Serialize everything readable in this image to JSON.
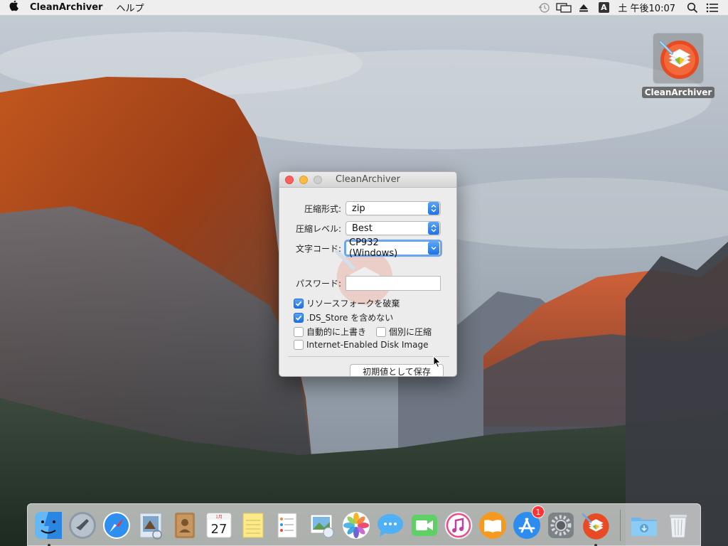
{
  "menubar": {
    "app_name": "CleanArchiver",
    "menus": [
      "ヘルプ"
    ],
    "input_source": "A",
    "clock": "土 午後10:07"
  },
  "desktop_icon": {
    "label": "CleanArchiver"
  },
  "window": {
    "title": "CleanArchiver",
    "compression_format": {
      "label": "圧縮形式:",
      "value": "zip"
    },
    "compression_level": {
      "label": "圧縮レベル:",
      "value": "Best"
    },
    "char_code": {
      "label": "文字コード:",
      "value": "CP932 (Windows)"
    },
    "password": {
      "label": "パスワード:",
      "value": ""
    },
    "checkboxes": {
      "discard_resource_fork": {
        "label": "リソースフォークを破棄",
        "checked": true
      },
      "exclude_ds_store": {
        "label": ".DS_Store を含めない",
        "checked": true
      },
      "auto_overwrite": {
        "label": "自動的に上書き",
        "checked": false
      },
      "compress_individually": {
        "label": "個別に圧縮",
        "checked": false
      },
      "internet_enabled_disk_image": {
        "label": "Internet-Enabled Disk Image",
        "checked": false
      }
    },
    "save_defaults_label": "初期値として保存"
  },
  "dock": {
    "calendar_month": "1月",
    "calendar_day": "27",
    "appstore_badge": "1"
  },
  "colors": {
    "accent": "#1f72e8",
    "close": "#fc605c",
    "minimize": "#fdbc40",
    "badge": "#ff3333"
  }
}
